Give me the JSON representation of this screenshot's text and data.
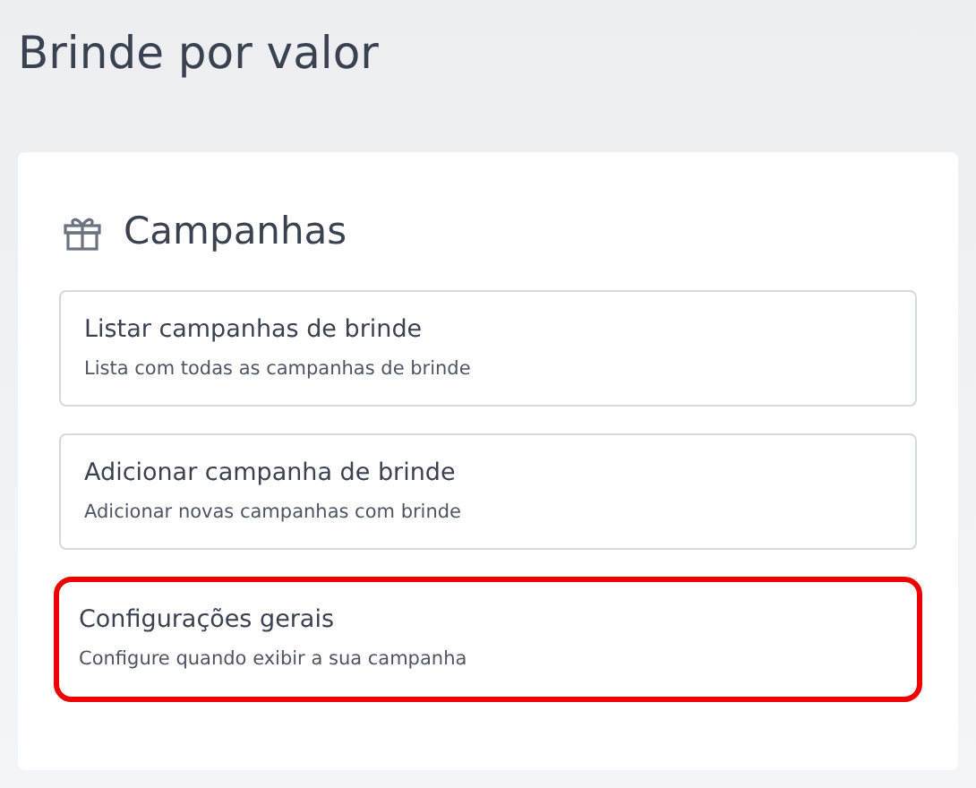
{
  "page": {
    "title": "Brinde por valor"
  },
  "panel": {
    "title": "Campanhas"
  },
  "options": [
    {
      "title": "Listar campanhas de brinde",
      "description": "Lista com todas as campanhas de brinde",
      "highlighted": false
    },
    {
      "title": "Adicionar campanha de brinde",
      "description": "Adicionar novas campanhas com brinde",
      "highlighted": false
    },
    {
      "title": "Configurações gerais",
      "description": "Configure quando exibir a sua campanha",
      "highlighted": true
    }
  ]
}
